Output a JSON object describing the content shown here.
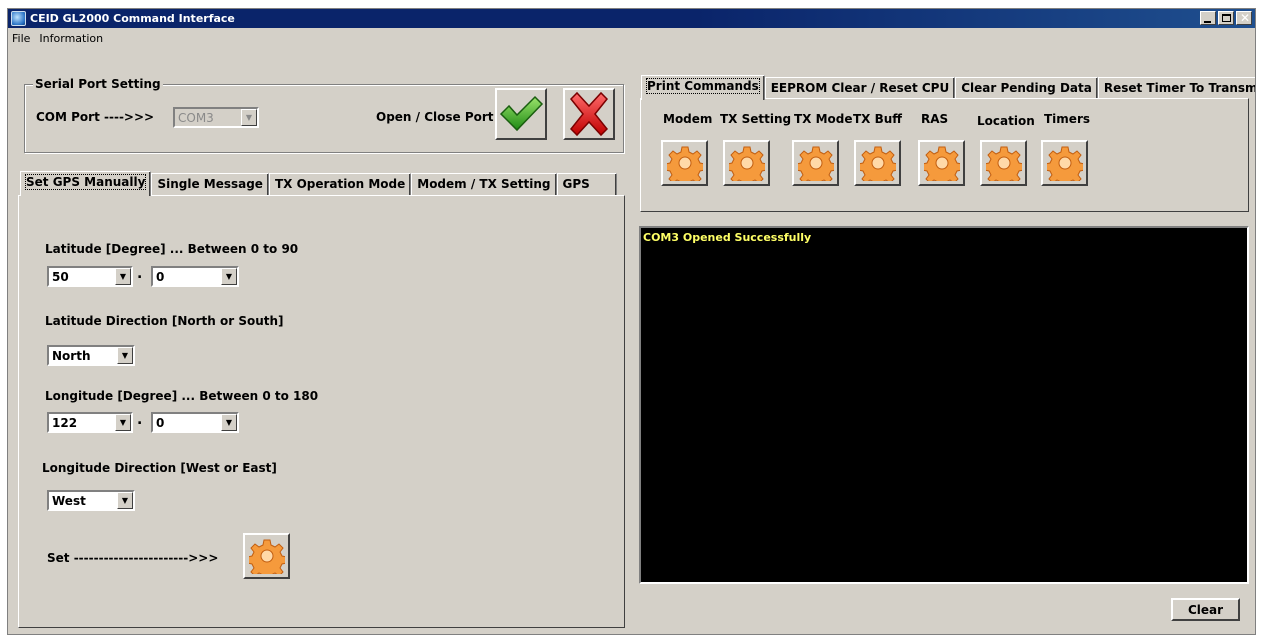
{
  "window": {
    "title": "CEID GL2000 Command Interface"
  },
  "menu": {
    "items": [
      "File",
      "Information"
    ]
  },
  "serial_port": {
    "group_label": "Serial Port Setting",
    "com_port_label": "COM Port ---->>>",
    "com_port_value": "COM3",
    "open_close_label": "Open / Close Port"
  },
  "left_tabs": [
    "Set GPS Manually",
    "Single Message",
    "TX Operation Mode",
    "Modem / TX Setting",
    "GPS"
  ],
  "gps_manual": {
    "lat_label": "Latitude [Degree] ... Between 0 to 90",
    "lat_deg": "50",
    "lat_dec": "0",
    "lat_dir_label": "Latitude Direction [North or South]",
    "lat_dir": "North",
    "lon_label": "Longitude [Degree] ... Between 0 to 180",
    "lon_deg": "122",
    "lon_dec": "0",
    "lon_dir_label": "Longitude Direction [West or East]",
    "lon_dir": "West",
    "set_label": "Set ----------------------->>>",
    "dot": "."
  },
  "right_tabs": [
    "Print Commands",
    "EEPROM Clear / Reset CPU",
    "Clear Pending Data",
    "Reset Timer To Transmit"
  ],
  "print_commands": {
    "buttons": [
      "Modem",
      "TX Setting",
      "TX Mode",
      "TX Buff",
      "RAS",
      "Location",
      "Timers"
    ]
  },
  "console": {
    "line": "COM3  Opened Successfully"
  },
  "clear_button": "Clear",
  "colors": {
    "titlebar": "#0a246a",
    "console_bg": "#000000",
    "console_text": "#ffff66",
    "gear": "#f59a3c"
  }
}
